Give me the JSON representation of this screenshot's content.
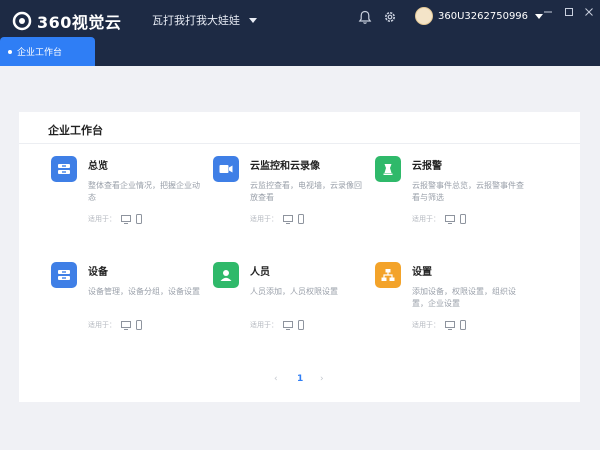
{
  "header": {
    "logo_text": "360视觉云",
    "org_name": "瓦打我打我大娃娃",
    "username": "360U3262750996"
  },
  "tabs": [
    {
      "label": "企业工作台",
      "active": true
    }
  ],
  "workspace": {
    "title": "企业工作台",
    "applies_label": "适用于：",
    "items": [
      {
        "name": "总览",
        "desc": "整体查看企业情况，把握企业动态",
        "color": "#3f7fe6",
        "icon": "overview-icon"
      },
      {
        "name": "云监控和云录像",
        "desc": "云监控查看，电视墙，云录像回放查看",
        "color": "#3f7fe6",
        "icon": "camera-icon"
      },
      {
        "name": "云报警",
        "desc": "云报警事件总览，云报警事件查看与筛选",
        "color": "#2fb96a",
        "icon": "alarm-icon"
      },
      {
        "name": "设备",
        "desc": "设备管理，设备分组，设备设置",
        "color": "#3f7fe6",
        "icon": "device-icon"
      },
      {
        "name": "人员",
        "desc": "人员添加，人员权限设置",
        "color": "#2fb96a",
        "icon": "person-icon"
      },
      {
        "name": "设置",
        "desc": "添加设备，权限设置，组织设置，企业设置",
        "color": "#f3a32a",
        "icon": "settings-org-icon"
      }
    ]
  },
  "pagination": {
    "prev": "‹",
    "current": "1",
    "next": "›"
  },
  "colors": {
    "header_bg": "#1d2a44",
    "accent": "#2f7ef5",
    "page_bg": "#f0f1f5"
  }
}
